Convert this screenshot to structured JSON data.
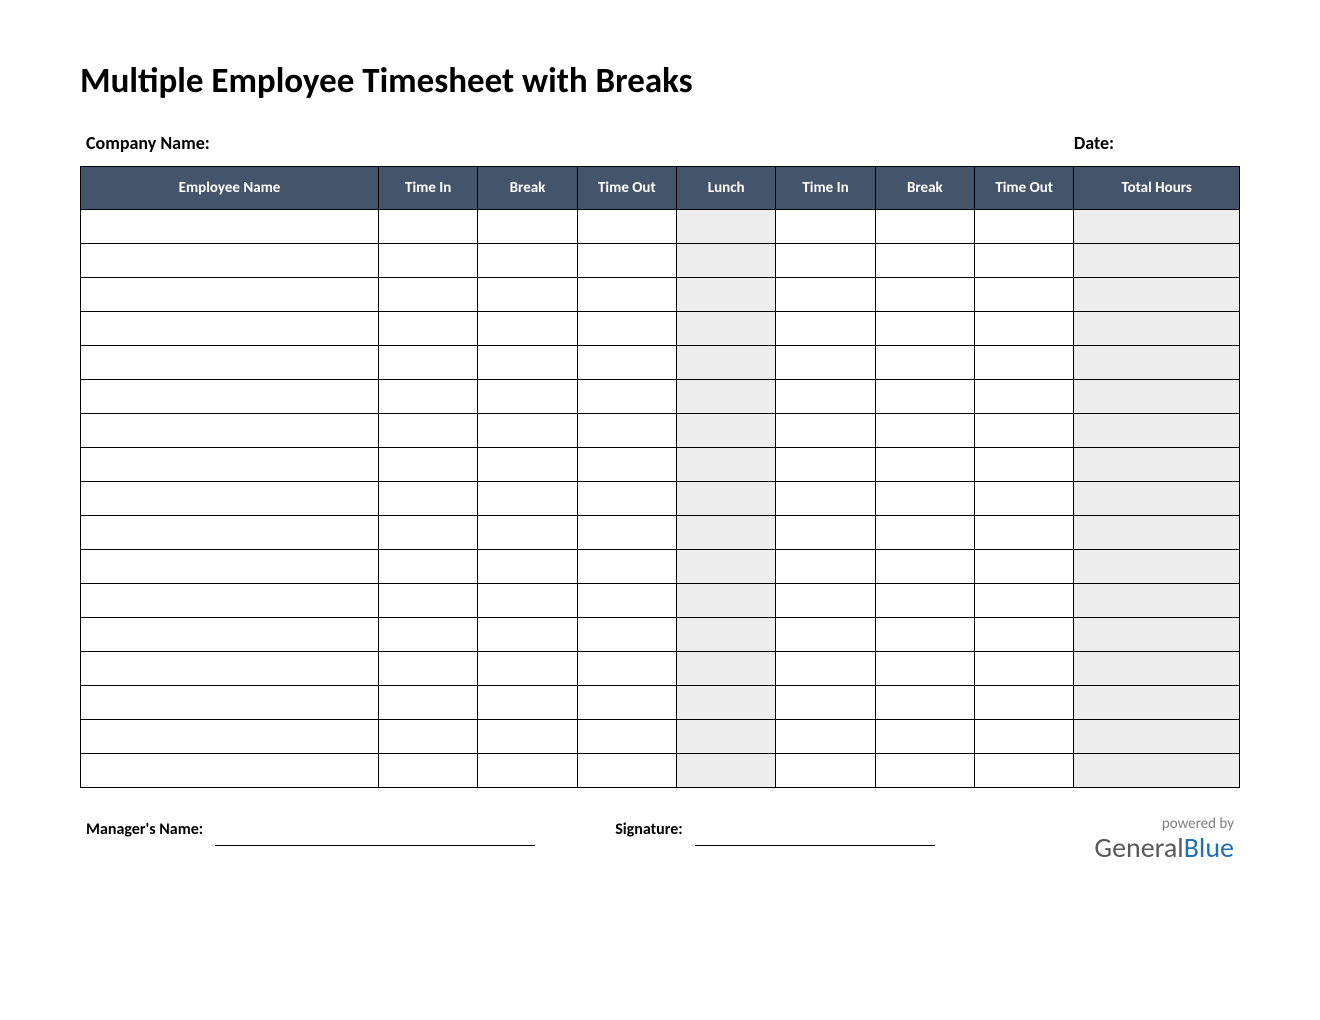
{
  "title": "Multiple Employee Timesheet with Breaks",
  "meta": {
    "company_label": "Company Name:",
    "date_label": "Date:"
  },
  "columns": [
    "Employee Name",
    "Time In",
    "Break",
    "Time Out",
    "Lunch",
    "Time In",
    "Break",
    "Time Out",
    "Total Hours"
  ],
  "row_count": 17,
  "shaded_columns": [
    4,
    8
  ],
  "footer": {
    "manager_label": "Manager's Name:",
    "signature_label": "Signature:"
  },
  "brand": {
    "powered_by": "powered by",
    "name_part1": "General",
    "name_part2": "Blue"
  },
  "colors": {
    "header_bg": "#44546a",
    "shaded_bg": "#ededed",
    "brand_blue": "#1f6fb5"
  }
}
